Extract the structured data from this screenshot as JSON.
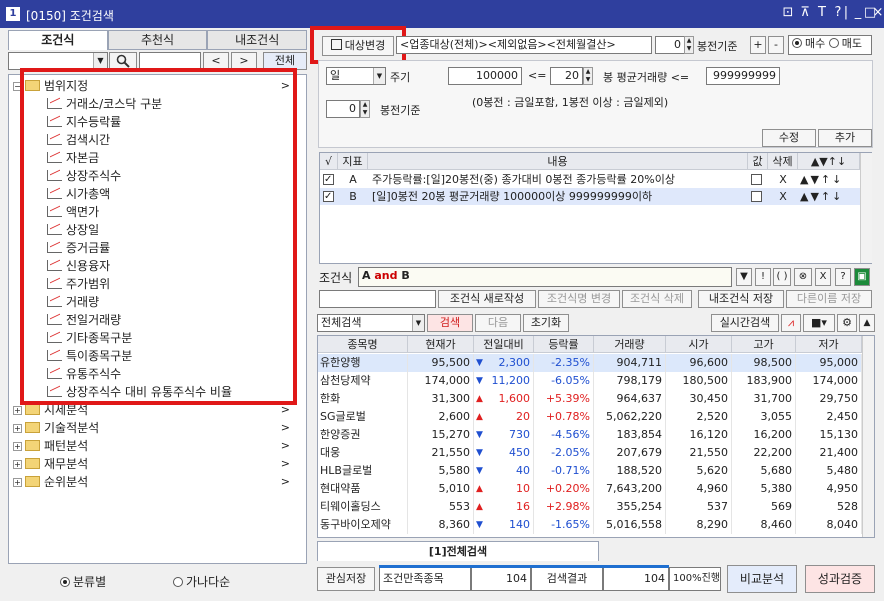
{
  "window": {
    "icon_label": "1",
    "title": "[0150] 조건검색",
    "controls": [
      "⊡",
      "⊼",
      "T",
      "?",
      "|",
      "_",
      "□",
      "×"
    ]
  },
  "left": {
    "tabs": [
      "조건식",
      "추천식",
      "내조건식"
    ],
    "search": {
      "prev": "<",
      "next": ">",
      "all": "전체"
    },
    "tree": {
      "root": "범위지정",
      "leaves": [
        "거래소/코스닥 구분",
        "지수등락률",
        "검색시간",
        "자본금",
        "상장주식수",
        "시가총액",
        "액면가",
        "상장일",
        "증거금률",
        "신용융자",
        "주가범위",
        "거래량",
        "전일거래량",
        "기타종목구분",
        "특이종목구분",
        "유통주식수",
        "상장주식수 대비 유통주식수 비율"
      ],
      "folders": [
        "시세분석",
        "기술적분석",
        "패턴분석",
        "재무분석",
        "순위분석"
      ]
    },
    "radios": [
      {
        "label": "분류별",
        "checked": true
      },
      {
        "label": "가나다순",
        "checked": false
      }
    ]
  },
  "top": {
    "target_button": "대상변경",
    "target_text": "<업종대상(전체)><제외없음><전체월결산>",
    "bars_value": "0",
    "bars_label": "봉전기준",
    "plus": "+",
    "minus": "-",
    "radio_buy": "매수",
    "radio_sell": "매도"
  },
  "params": {
    "period_value": "일",
    "period_label": "주기",
    "min_value": "100000",
    "le1": "<=",
    "bar_count": "20",
    "avg_label": "봉 평균거래량 <=",
    "max_value": "999999999",
    "base_value": "0",
    "base_label": "봉전기준",
    "note": "(0봉전 : 금일포함, 1봉전 이상 : 금일제외)",
    "edit": "수정",
    "add": "추가"
  },
  "cond_grid": {
    "headers": [
      "√",
      "지표",
      "내용",
      "값",
      "삭제",
      "▲▼↑↓"
    ],
    "rows": [
      {
        "checked": true,
        "id": "A",
        "content": "주가등락률:[일]20봉전(중) 종가대비 0봉전 종가등락률 20%이상",
        "del": "X",
        "moves": "▲▼↑↓"
      },
      {
        "checked": true,
        "id": "B",
        "content": "[일]0봉전 20봉 평균거래량 100000이상 999999999이하",
        "del": "X",
        "moves": "▲▼↑↓"
      }
    ]
  },
  "formula": {
    "label": "조건식",
    "a": "A",
    "and": "and",
    "b": "B",
    "buttons": [
      "▼",
      "!",
      "( )",
      "⊗",
      "X",
      "?",
      "▣"
    ]
  },
  "actions": {
    "new": "조건식 새로작성",
    "rename": "조건식명 변경",
    "delete": "조건식 삭제",
    "save": "내조건식 저장",
    "save_as": "다른이름 저장"
  },
  "search_bar": {
    "scope": "전체검색",
    "search": "검색",
    "next": "다음",
    "reset": "초기화",
    "realtime": "실시간검색",
    "icons": [
      "chart-icon",
      "menu-icon",
      "gear-icon",
      "up-icon"
    ]
  },
  "stock_table": {
    "headers": [
      "종목명",
      "현재가",
      "전일대비",
      "등락률",
      "거래량",
      "시가",
      "고가",
      "저가"
    ],
    "rows": [
      {
        "name": "유한양행",
        "price": "95,500",
        "dir": "dn",
        "chg": "2,300",
        "rate": "-2.35%",
        "vol": "904,711",
        "open": "96,600",
        "high": "98,500",
        "low": "95,000",
        "sel": true
      },
      {
        "name": "삼천당제약",
        "price": "174,000",
        "dir": "dn",
        "chg": "11,200",
        "rate": "-6.05%",
        "vol": "798,179",
        "open": "180,500",
        "high": "183,900",
        "low": "174,000"
      },
      {
        "name": "한화",
        "price": "31,300",
        "dir": "up",
        "chg": "1,600",
        "rate": "+5.39%",
        "vol": "964,637",
        "open": "30,450",
        "high": "31,700",
        "low": "29,750"
      },
      {
        "name": "SG글로벌",
        "price": "2,600",
        "dir": "up",
        "chg": "20",
        "rate": "+0.78%",
        "vol": "5,062,220",
        "open": "2,520",
        "high": "3,055",
        "low": "2,450"
      },
      {
        "name": "한양증권",
        "price": "15,270",
        "dir": "dn",
        "chg": "730",
        "rate": "-4.56%",
        "vol": "183,854",
        "open": "16,120",
        "high": "16,200",
        "low": "15,130"
      },
      {
        "name": "대웅",
        "price": "21,550",
        "dir": "dn",
        "chg": "450",
        "rate": "-2.05%",
        "vol": "207,679",
        "open": "21,550",
        "high": "22,200",
        "low": "21,400"
      },
      {
        "name": "HLB글로벌",
        "price": "5,580",
        "dir": "dn",
        "chg": "40",
        "rate": "-0.71%",
        "vol": "188,520",
        "open": "5,620",
        "high": "5,680",
        "low": "5,480"
      },
      {
        "name": "현대약품",
        "price": "5,010",
        "dir": "up",
        "chg": "10",
        "rate": "+0.20%",
        "vol": "7,643,200",
        "open": "4,960",
        "high": "5,380",
        "low": "4,950"
      },
      {
        "name": "티웨이홀딩스",
        "price": "553",
        "dir": "up",
        "chg": "16",
        "rate": "+2.98%",
        "vol": "355,254",
        "open": "537",
        "high": "569",
        "low": "528"
      },
      {
        "name": "동구바이오제약",
        "price": "8,360",
        "dir": "dn",
        "chg": "140",
        "rate": "-1.65%",
        "vol": "5,016,558",
        "open": "8,290",
        "high": "8,460",
        "low": "8,040"
      }
    ]
  },
  "result_tab": "[1]전체검색",
  "bottom": {
    "watch_save": "관심저장",
    "count_label": "조건만족종목",
    "count": "104",
    "result_label": "검색결과",
    "result": "104",
    "progress": "100%진행",
    "progress_value": 100,
    "compare": "비교분석",
    "verify": "성과검증"
  },
  "colors": {
    "title": "#2f3f9e",
    "highlight": "#e01818",
    "up": "#e02020",
    "down": "#1f4fd0"
  }
}
